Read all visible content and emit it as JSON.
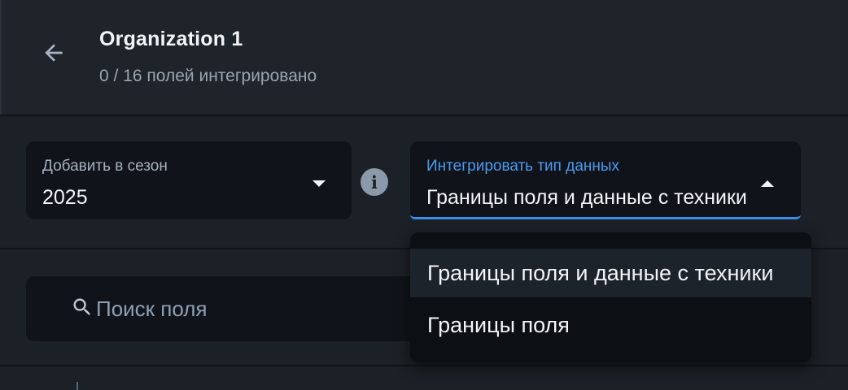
{
  "header": {
    "title": "Organization 1",
    "subtitle": "0 / 16 полей интегрировано"
  },
  "season_select": {
    "label": "Добавить в сезон",
    "value": "2025"
  },
  "data_type_select": {
    "label": "Интегрировать тип данных",
    "value": "Границы поля и данные с техники",
    "state": "open"
  },
  "dropdown": {
    "options": [
      {
        "label": "Границы поля и данные с техники",
        "selected": true
      },
      {
        "label": "Границы поля",
        "selected": false
      }
    ]
  },
  "search": {
    "placeholder": "Поиск поля",
    "value": ""
  },
  "icons": {
    "back": "arrow-left-icon",
    "season_caret": "caret-down-icon",
    "info": "info-icon",
    "data_caret": "caret-up-icon",
    "search": "search-icon"
  },
  "colors": {
    "background": "#1c2127",
    "surface": "#10141a",
    "accent": "#3b8fe8",
    "text_primary": "#f2f4f7",
    "text_secondary": "#9aa4b1"
  }
}
